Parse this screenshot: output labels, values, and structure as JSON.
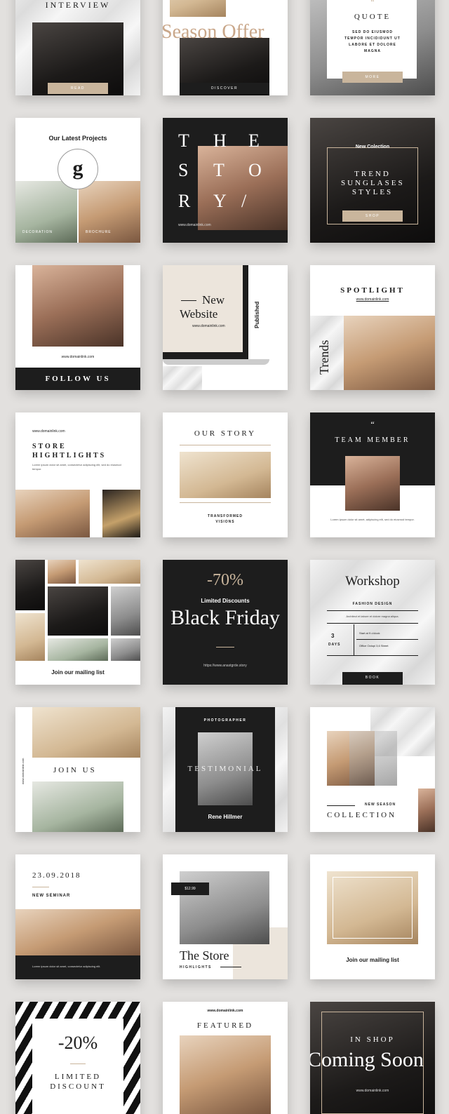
{
  "tiles": {
    "interview": {
      "title": "INTERVIEW",
      "button": "READ"
    },
    "season": {
      "title": "Season Offer",
      "button": "DISCOVER"
    },
    "quote": {
      "mark": "“",
      "title": "QUOTE",
      "body": "SED DO EIUSMOD TEMPOR INCIDIDUNT UT LABORE ET DOLORE MAGNA",
      "button": "MORE"
    },
    "projects": {
      "title": "Our Latest Projects",
      "logo_letter": "g",
      "caption_left": "DECORATION",
      "caption_right": "BROCHURE"
    },
    "story": {
      "letters": [
        "T",
        "H",
        "E",
        "S",
        "T",
        "O",
        "R",
        "Y",
        "/"
      ],
      "url": "www.domainlink.com"
    },
    "collection": {
      "kicker": "New Colection",
      "title": "TREND SUNGLASES STYLES",
      "button": "SHOP"
    },
    "follow": {
      "url": "www.domainlink.com",
      "button": "FOLLOW US"
    },
    "website": {
      "title_line1": "New",
      "title_line2": "Website",
      "url": "www.domainlink.com",
      "side": "Published"
    },
    "spotlight": {
      "title": "SPOTLIGHT",
      "url": "www.domainlink.com",
      "side": "Trends"
    },
    "highlights": {
      "url": "www.domainlink.com",
      "title": "STORE HIGHTLIGHTS",
      "body": "Lorem ipsum dolor sit amet, consectetur adipiscing elit, sed do eiusmod tempor."
    },
    "ourstory": {
      "title": "OUR STORY",
      "caption": "TRANSFORMED VISIONS"
    },
    "team": {
      "mark": "“",
      "title": "TEAM MEMBER",
      "body": "Lorem ipsum dolor sit amet, adipiscing elit, sed do eiusmod tempor."
    },
    "mailing": {
      "caption": "Join our mailing list"
    },
    "blackfriday": {
      "discount": "-70%",
      "kicker": "Limited Discounts",
      "title": "Black Friday",
      "url": "https://www.anastgrde.story"
    },
    "workshop": {
      "title": "Workshop",
      "subtitle": "FASHION DESIGN",
      "desc": "Architect et labore et dolore magna aliqua.",
      "days_num": "3",
      "days_label": "DAYS",
      "row1": "Start at 9 o'clock",
      "row2": "Office Octopi 3,6 Street",
      "button": "BOOK"
    },
    "join": {
      "side": "www.domainlink.com",
      "title": "JOIN US"
    },
    "testimonial": {
      "kicker": "PHOTOGRAPHER",
      "title": "TESTIMONIAL",
      "name": "Rene Hillmer"
    },
    "newseason": {
      "kicker": "NEW SEASON",
      "title": "COLLECTION"
    },
    "seminar": {
      "date": "23.09.2018",
      "title": "NEW SEMINAR",
      "body": "Lorem ipsum dolor sit amet, consectetur adipiscing elit."
    },
    "store": {
      "price": "$12.99",
      "title": "The Store",
      "sub": "HIGHLIGHTS"
    },
    "mailing2": {
      "caption": "Join our mailing list"
    },
    "discount": {
      "value": "-20%",
      "title": "LIMITED DISCOUNT"
    },
    "featured": {
      "url": "www.domainlink.com",
      "title": "FEATURED"
    },
    "coming": {
      "kicker": "IN SHOP",
      "title": "Coming Soon",
      "url": "www.domainlink.com"
    }
  },
  "colors": {
    "accent": "#c9b59c",
    "dark": "#1d1d1d",
    "beige": "#ece5dc"
  }
}
